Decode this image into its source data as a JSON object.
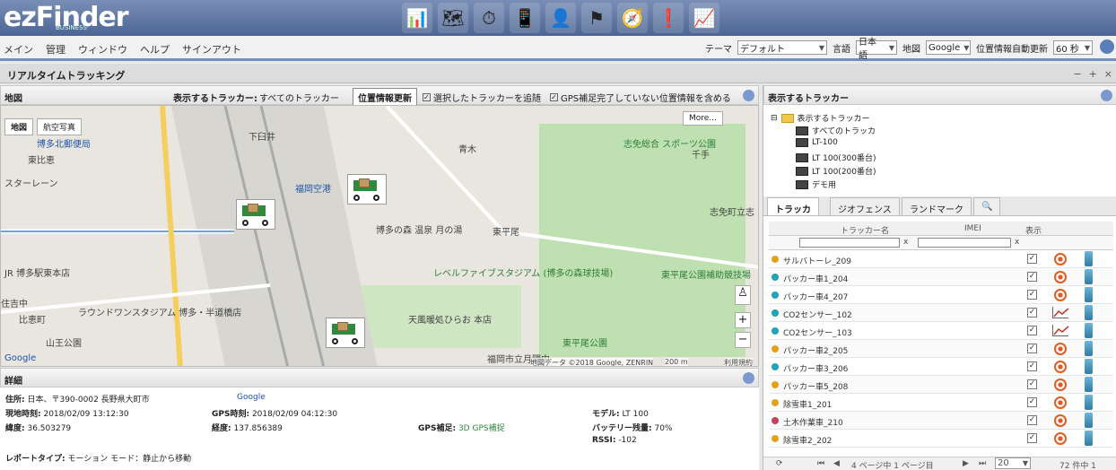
{
  "header": {
    "logo": "ezFinder",
    "logo_sub": "BUSINESS",
    "toolbar_icons": [
      "presentation-icon",
      "map-icon",
      "clock-icon",
      "phone-icon",
      "user-icon",
      "flag-icon",
      "route-icon",
      "alert-icon",
      "report-icon"
    ]
  },
  "menu": {
    "items": [
      "メイン",
      "管理",
      "ウィンドウ",
      "ヘルプ",
      "サインアウト"
    ],
    "theme_label": "テーマ",
    "theme_value": "デフォルト",
    "lang_label": "言語",
    "lang_value": "日本語",
    "mapprov_label": "地図",
    "mapprov_value": "Google",
    "auto_label": "位置情報自動更新",
    "auto_value": "60 秒"
  },
  "title": "リアルタイムトラッキング",
  "map_panel": {
    "title": "地図",
    "show_trackers_label": "表示するトラッカー:",
    "show_trackers_value": "すべてのトラッカー",
    "update_button": "位置情報更新",
    "cb_selected": "選択したトラッカーを追随",
    "cb_gps": "GPS補足完了していない位置情報を含める",
    "map_type": "地図",
    "satellite": "航空写真",
    "more": "More...",
    "labels": {
      "post": "博多北郵便局",
      "east": "東比恵",
      "lane": "スターレーン",
      "seseki": "東比恵",
      "shimohara": "下臼井",
      "fukuoka_airport": "福岡空港",
      "aoki_cho": "青木",
      "sports_park": "志免総合\nスポーツ公園",
      "chitose": "千手",
      "shime": "志免町立志",
      "moon": "博多の森 温泉 月の湯",
      "toyohira": "東平尾",
      "hakata_sta": "JR 博多駅東本店",
      "level5": "レベルファイブスタジアム\n(博多の森球技場)",
      "park": "東平尾公園補助競技場",
      "round1": "ラウンドワンスタジアム\n博多・半道橋店",
      "mikasa": "比恵町",
      "sanno": "山王公園",
      "tenjin": "天風暖処ひらお 本店",
      "higashi_park": "東平尾公園",
      "fukuoka_city": "福岡市立月隈中",
      "shiyaku": "住吉中",
      "googlelabel": "Google",
      "copyright": "地図データ ©2018 Google, ZENRIN",
      "scale": "200 m",
      "terms": "利用規約"
    }
  },
  "details": {
    "title": "詳細",
    "address_label": "住所:",
    "address_value": "日本、〒390-0002 長野県大町市",
    "google": "Google",
    "local_time_label": "現地時刻:",
    "local_time_value": "2018/02/09 13:12:30",
    "gps_time_label": "GPS時刻:",
    "gps_time_value": "2018/02/09 04:12:30",
    "model_label": "モデル:",
    "model_value": "LT 100",
    "lat_label": "緯度:",
    "lat_value": "36.503279",
    "lng_label": "経度:",
    "lng_value": "137.856389",
    "gps_label": "GPS補足:",
    "gps_value": "3D GPS補捉",
    "battery_label": "バッテリー残量:",
    "battery_value": "70%",
    "rssi_label": "RSSI:",
    "rssi_value": "-102",
    "report_label": "レポートタイプ:",
    "report_value": "モーション モード：静止から移動"
  },
  "right_panel": {
    "title": "表示するトラッカー",
    "tree_root": "表示するトラッカー",
    "tree_items": [
      "すべてのトラッカ",
      "LT-100",
      "LT 100(300番台)",
      "LT 100(200番台)",
      "デモ用"
    ],
    "tabs": [
      "トラッカ",
      "ジオフェンス",
      "ランドマーク"
    ],
    "col_name": "トラッカー名",
    "col_imei": "IMEI",
    "col_show": "表示",
    "filter_x": "x",
    "rows": [
      {
        "name": "サルバトーレ_209",
        "color": "#e6a11c",
        "icon": "target"
      },
      {
        "name": "パッカー車1_204",
        "color": "#1fa3b8",
        "icon": "target"
      },
      {
        "name": "パッカー車4_207",
        "color": "#1fa3b8",
        "icon": "target"
      },
      {
        "name": "CO2センサー_102",
        "color": "#1fa3b8",
        "icon": "chart"
      },
      {
        "name": "CO2センサー_103",
        "color": "#1fa3b8",
        "icon": "chart"
      },
      {
        "name": "パッカー車2_205",
        "color": "#e6a11c",
        "icon": "target"
      },
      {
        "name": "パッカー車3_206",
        "color": "#1fa3b8",
        "icon": "target"
      },
      {
        "name": "パッカー車5_208",
        "color": "#e6a11c",
        "icon": "target"
      },
      {
        "name": "除雪車1_201",
        "color": "#e6a11c",
        "icon": "target"
      },
      {
        "name": "土木作業車_210",
        "color": "#c2415e",
        "icon": "target"
      },
      {
        "name": "除雪車2_202",
        "color": "#e6a11c",
        "icon": "target"
      }
    ],
    "pager_text": "4 ページ中 1 ページ目",
    "page_value": "1",
    "per_page": "20",
    "total": "72 件中 1"
  }
}
